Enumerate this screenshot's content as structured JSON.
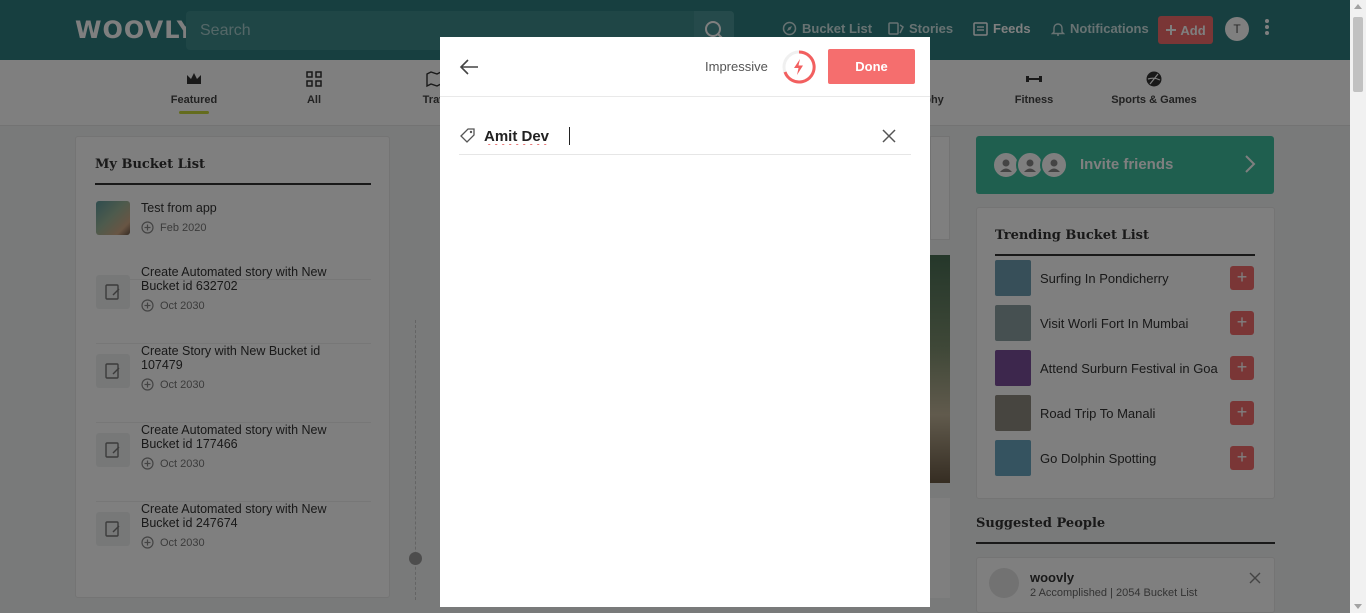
{
  "header": {
    "logo": "WOOVLY",
    "search_placeholder": "Search",
    "nav": [
      {
        "label": "Bucket List",
        "icon": "compass-icon"
      },
      {
        "label": "Stories",
        "icon": "stories-icon"
      },
      {
        "label": "Feeds",
        "icon": "feeds-icon"
      },
      {
        "label": "Notifications",
        "icon": "bell-icon"
      }
    ],
    "add_label": "Add",
    "avatar_initial": "T"
  },
  "categories": [
    {
      "label": "Featured",
      "icon": "crown-icon",
      "active": true
    },
    {
      "label": "All",
      "icon": "grid-icon"
    },
    {
      "label": "Trav",
      "icon": "map-icon"
    },
    {
      "label": "phy",
      "icon": "camera-icon"
    },
    {
      "label": "Fitness",
      "icon": "dumbbell-icon"
    },
    {
      "label": "Sports & Games",
      "icon": "ball-icon"
    }
  ],
  "bucket_list": {
    "title": "My Bucket List",
    "items": [
      {
        "title": "Test from app",
        "date": "Feb 2020"
      },
      {
        "title": "Create Automated story with New Bucket id 632702",
        "date": "Oct 2030"
      },
      {
        "title": "Create Story with New Bucket id 107479",
        "date": "Oct 2030"
      },
      {
        "title": "Create Automated story with New Bucket id 177466",
        "date": "Oct 2030"
      },
      {
        "title": "Create Automated story with New Bucket id 247674",
        "date": "Oct 2030"
      }
    ]
  },
  "invite": {
    "label": "Invite friends"
  },
  "trending": {
    "title": "Trending Bucket List",
    "items": [
      {
        "label": "Surfing In Pondicherry",
        "color": "#6f9fb2"
      },
      {
        "label": "Visit Worli Fort In Mumbai",
        "color": "#8da0a3"
      },
      {
        "label": "Attend Surburn Festival in Goa",
        "color": "#7a4e9a"
      },
      {
        "label": "Road Trip To Manali",
        "color": "#8f8a80"
      },
      {
        "label": "Go Dolphin Spotting",
        "color": "#6aa7c0"
      }
    ],
    "add_symbol": "+"
  },
  "suggested": {
    "title": "Suggested People",
    "name": "woovly",
    "stats": "2 Accomplished | 2054 Bucket List"
  },
  "modal": {
    "impressive_label": "Impressive",
    "done_label": "Done",
    "tag_value": "Amit Dev"
  },
  "colors": {
    "accent": "#f56e6e",
    "header": "#2f7f80",
    "invite": "#3fbf9f"
  }
}
